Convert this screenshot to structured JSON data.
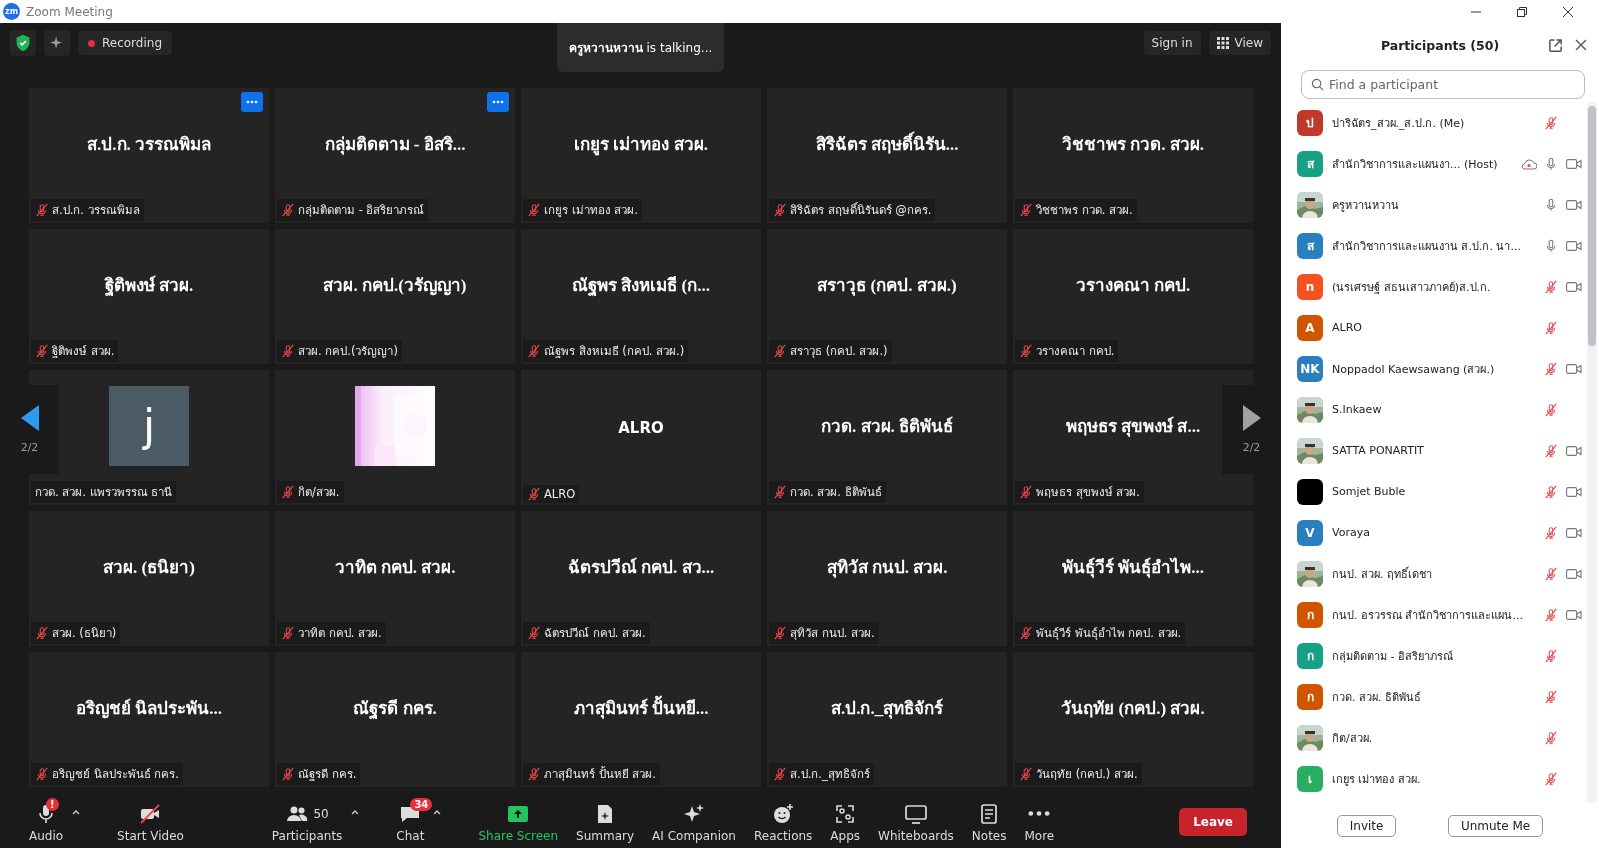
{
  "window": {
    "logo_text": "zm",
    "title": "Zoom Meeting"
  },
  "top_bar": {
    "recording_label": "Recording",
    "talking": "**ครูหวานหวาน** is  talking...",
    "sign_in": "Sign in",
    "view": "View"
  },
  "tiles": [
    {
      "kind": "name",
      "name": "ส.ป.ก. วรรณพิมล",
      "label": "ส.ป.ก. วรรณพิมล",
      "muted": true,
      "more_button": true
    },
    {
      "kind": "name",
      "name": "กลุ่มติดตาม - อิสริ...",
      "label": "กลุ่มติดตาม - อิสริยาภรณ์",
      "muted": true,
      "more_button": true
    },
    {
      "kind": "name",
      "name": "เกยูร เม่าทอง สวผ.",
      "label": "เกยูร เม่าทอง สวผ.",
      "muted": true,
      "more_button": false
    },
    {
      "kind": "name",
      "name": "สิริฉัตร สฤษดิ์นิรัน...",
      "label": "สิริฉัตร สฤษดิ์นิรันดร์ @กคร.",
      "muted": true,
      "more_button": false
    },
    {
      "kind": "name",
      "name": "วิชชาพร กวด. สวผ.",
      "label": "วิชชาพร กวด. สวผ.",
      "muted": true,
      "more_button": false
    },
    {
      "kind": "name",
      "name": "ฐิติพงษ์ สวผ.",
      "label": "ฐิติพงษ์ สวผ.",
      "muted": true,
      "more_button": false
    },
    {
      "kind": "name",
      "name": "สวผ. กคป.(วรัญญา)",
      "label": "สวผ. กคป.(วรัญญา)",
      "muted": true,
      "more_button": false
    },
    {
      "kind": "name",
      "name": "ณัฐพร สิงหเมธี (ก...",
      "label": "ณัฐพร สิงหเมธี (กคป. สวผ.)",
      "muted": true,
      "more_button": false
    },
    {
      "kind": "name",
      "name": "สราวุธ (กคป. สวผ.)",
      "label": "สราวุธ (กคป. สวผ.)",
      "muted": true,
      "more_button": false
    },
    {
      "kind": "name",
      "name": "วรางคณา กคป.",
      "label": "วรางคณา กคป.",
      "muted": true,
      "more_button": false
    },
    {
      "kind": "avatar",
      "name": "j",
      "label": "กวด. สวผ. แพรวพรรณ ธานี",
      "muted": false,
      "more_button": false
    },
    {
      "kind": "picture",
      "label": "กิต/สวผ.",
      "muted": true,
      "more_button": false
    },
    {
      "kind": "title",
      "name": "ALRO",
      "label": "ALRO",
      "muted": true,
      "more_button": false
    },
    {
      "kind": "name",
      "name": "กวด. สวผ. ธิติพันธ์",
      "label": "กวด. สวผ. ธิติพันธ์",
      "muted": true,
      "more_button": false
    },
    {
      "kind": "name",
      "name": "พฤษธร สุขพงษ์ ส...",
      "label": "พฤษธร สุขพงษ์ สวผ.",
      "muted": true,
      "more_button": false
    },
    {
      "kind": "name",
      "name": "สวผ. (ธนิยา)",
      "label": "สวผ. (ธนิยา)",
      "muted": true,
      "more_button": false
    },
    {
      "kind": "name",
      "name": "วาทิต กคป. สวผ.",
      "label": "วาทิต กคป. สวผ.",
      "muted": true,
      "more_button": false
    },
    {
      "kind": "name",
      "name": "ฉัตรปวีณ์ กคป. สว...",
      "label": "ฉัตรปวีณ์ กคป. สวผ.",
      "muted": true,
      "more_button": false
    },
    {
      "kind": "name",
      "name": "สุทิวัส กนป. สวผ.",
      "label": "สุทิวัส กนป. สวผ.",
      "muted": true,
      "more_button": false
    },
    {
      "kind": "name",
      "name": "พันธุ์วีร์ พันธุ์อำไพ...",
      "label": "พันธุ์วีร์ พันธุ์อำไพ กคป. สวผ.",
      "muted": true,
      "more_button": false
    },
    {
      "kind": "name",
      "name": "อริญชย์ นิลประพัน...",
      "label": "อริญชย์ นิลประพันธ์ กคร.",
      "muted": true,
      "more_button": false
    },
    {
      "kind": "name",
      "name": "ณัฐรดี กคร.",
      "label": "ณัฐรดี กคร.",
      "muted": true,
      "more_button": false
    },
    {
      "kind": "name",
      "name": "ภาสุมินทร์ ปั้นหยี...",
      "label": "ภาสุมินทร์ ปั้นหยี  สวผ.",
      "muted": true,
      "more_button": false
    },
    {
      "kind": "name",
      "name": "ส.ป.ก._สุทธิจักร์",
      "label": "ส.ป.ก._สุทธิจักร์",
      "muted": true,
      "more_button": false
    },
    {
      "kind": "name",
      "name": "วันฤทัย (กคป.) สวผ.",
      "label": "วันฤทัย (กคป.) สวผ.",
      "muted": true,
      "more_button": false
    }
  ],
  "page_nav": {
    "previous": "2/2",
    "next": "2/2"
  },
  "toolbar": [
    {
      "kind": "audio",
      "label": "Audio",
      "badge": "!",
      "caret": true
    },
    {
      "kind": "video",
      "label": "Start Video",
      "caret": false
    },
    {
      "kind": "participants",
      "label": "Participants",
      "count": "50",
      "caret": true
    },
    {
      "kind": "chat",
      "label": "Chat",
      "badge": "34",
      "caret": true
    },
    {
      "kind": "share",
      "label": "Share Screen",
      "caret": false
    },
    {
      "kind": "summary",
      "label": "Summary",
      "caret": false
    },
    {
      "kind": "ai",
      "label": "AI Companion",
      "caret": false
    },
    {
      "kind": "reactions",
      "label": "Reactions",
      "caret": false
    },
    {
      "kind": "apps",
      "label": "Apps",
      "caret": false
    },
    {
      "kind": "whiteboards",
      "label": "Whiteboards",
      "caret": false
    },
    {
      "kind": "notes",
      "label": "Notes",
      "caret": false
    },
    {
      "kind": "more",
      "label": "More",
      "caret": false
    }
  ],
  "leave_button": "Leave",
  "panel": {
    "title": "Participants (50)",
    "search": {
      "placeholder": "Find a participant"
    },
    "participants": [
      {
        "kind": "letter",
        "letter": "ป",
        "color": "#c0392b",
        "name": "ปาริฉัตร_สวผ._ส.ป.ก. (Me)",
        "cloud": false,
        "muted": true,
        "camera": false
      },
      {
        "kind": "letter",
        "letter": "ส",
        "color": "#17a085",
        "name": "สำนักวิชาการและแผนงา... (Host)",
        "cloud": true,
        "muted": false,
        "camera": true
      },
      {
        "kind": "picture",
        "name": "ครูหวานหวาน",
        "cloud": false,
        "muted": false,
        "camera": true
      },
      {
        "kind": "letter",
        "letter": "ส",
        "color": "#2a7fc0",
        "name": "สำนักวิชาการและแผนงาน ส.ป.ก. นา...",
        "cloud": false,
        "muted": false,
        "camera": true
      },
      {
        "kind": "letter",
        "letter": "n",
        "color": "#f4511e",
        "name": "(นรเศรษฐ์ สธนเสาวภาคย์)ส.ป.ก.",
        "cloud": false,
        "muted": true,
        "camera": true
      },
      {
        "kind": "letter",
        "letter": "A",
        "color": "#d35400",
        "name": "ALRO",
        "cloud": false,
        "muted": true,
        "camera": false
      },
      {
        "kind": "letter",
        "letter": "NK",
        "color": "#2a7fc0",
        "name": "Noppadol Kaewsawang (สวผ.)",
        "cloud": false,
        "muted": true,
        "camera": true
      },
      {
        "kind": "picture",
        "name": "S.Inkaew",
        "cloud": false,
        "muted": true,
        "camera": false
      },
      {
        "kind": "picture",
        "name": "SATTA PONARTIT",
        "cloud": false,
        "muted": true,
        "camera": true
      },
      {
        "kind": "plain",
        "color": "#000000",
        "name": "Somjet Buble",
        "cloud": false,
        "muted": true,
        "camera": true
      },
      {
        "kind": "letter",
        "letter": "V",
        "color": "#2a7fc0",
        "name": "Voraya",
        "cloud": false,
        "muted": true,
        "camera": true
      },
      {
        "kind": "picture",
        "name": "กนป. สวผ. ฤทธิ์เดชา",
        "cloud": false,
        "muted": true,
        "camera": true
      },
      {
        "kind": "letter",
        "letter": "ก",
        "color": "#d35400",
        "name": "กนป. อรวรรณ สำนักวิชาการและแผน...",
        "cloud": false,
        "muted": true,
        "camera": true
      },
      {
        "kind": "letter",
        "letter": "ก",
        "color": "#17a085",
        "name": "กลุ่มติดตาม - อิสริยาภรณ์",
        "cloud": false,
        "muted": true,
        "camera": false
      },
      {
        "kind": "letter",
        "letter": "ก",
        "color": "#d35400",
        "name": "กวด. สวผ. ธิติพันธ์",
        "cloud": false,
        "muted": true,
        "camera": false
      },
      {
        "kind": "picture",
        "name": "กิต/สวผ.",
        "cloud": false,
        "muted": true,
        "camera": false
      },
      {
        "kind": "letter",
        "letter": "เ",
        "color": "#27ae60",
        "name": "เกยูร เม่าทอง สวผ.",
        "cloud": false,
        "muted": true,
        "camera": false
      }
    ],
    "buttons": [
      "Invite",
      "Unmute Me"
    ]
  }
}
